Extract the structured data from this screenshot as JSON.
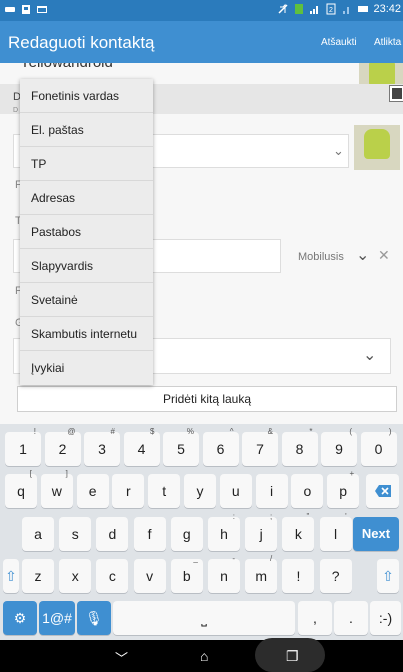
{
  "status": {
    "time": "23:42",
    "icons": [
      "keyboard-icon",
      "image-icon",
      "message-icon",
      "mute-icon",
      "battery-charge-icon",
      "signal-icon",
      "sim-icon",
      "battery-icon"
    ]
  },
  "header": {
    "title": "Redaguoti kontaktą",
    "cancel_label": "Atšaukti",
    "done_label": "Atlikta"
  },
  "form": {
    "partial_name_text": "Yellowandroid",
    "mobile_label": "Mobilusis",
    "add_field_label": "Pridėti kitą lauką"
  },
  "popup": {
    "items": [
      "Fonetinis vardas",
      "El. paštas",
      "TP",
      "Adresas",
      "Pastabos",
      "Slapyvardis",
      "Svetainė",
      "Skambutis internetu",
      "Įvykiai"
    ]
  },
  "keyboard": {
    "row1": [
      {
        "k": "1",
        "a": "!"
      },
      {
        "k": "2",
        "a": "@"
      },
      {
        "k": "3",
        "a": "#"
      },
      {
        "k": "4",
        "a": "$"
      },
      {
        "k": "5",
        "a": "%"
      },
      {
        "k": "6",
        "a": "^"
      },
      {
        "k": "7",
        "a": "&"
      },
      {
        "k": "8",
        "a": "*"
      },
      {
        "k": "9",
        "a": "("
      },
      {
        "k": "0",
        "a": ")"
      }
    ],
    "row2": [
      {
        "k": "q",
        "a": "["
      },
      {
        "k": "w",
        "a": "]"
      },
      {
        "k": "e",
        "a": ""
      },
      {
        "k": "r",
        "a": ""
      },
      {
        "k": "t",
        "a": ""
      },
      {
        "k": "y",
        "a": ""
      },
      {
        "k": "u",
        "a": ""
      },
      {
        "k": "i",
        "a": ""
      },
      {
        "k": "o",
        "a": ""
      },
      {
        "k": "p",
        "a": "+"
      }
    ],
    "row3": [
      {
        "k": "a",
        "a": ""
      },
      {
        "k": "s",
        "a": ""
      },
      {
        "k": "d",
        "a": ""
      },
      {
        "k": "f",
        "a": ""
      },
      {
        "k": "g",
        "a": ""
      },
      {
        "k": "h",
        "a": ":"
      },
      {
        "k": "j",
        "a": ";"
      },
      {
        "k": "k",
        "a": "\""
      },
      {
        "k": "l",
        "a": "'"
      }
    ],
    "row4": [
      {
        "k": "z",
        "a": ""
      },
      {
        "k": "x",
        "a": ""
      },
      {
        "k": "c",
        "a": ""
      },
      {
        "k": "v",
        "a": ""
      },
      {
        "k": "b",
        "a": "_"
      },
      {
        "k": "n",
        "a": "-"
      },
      {
        "k": "m",
        "a": "/"
      },
      {
        "k": "!",
        "a": ""
      },
      {
        "k": "?",
        "a": ""
      }
    ],
    "next_label": "Next",
    "sym_label": "1@#",
    "comma": ",",
    "period": ".",
    "smiley": ":-)"
  },
  "colors": {
    "status_bar": "#2b7bbc",
    "action_bar": "#3f8fd1",
    "accent": "#3f8fd1"
  }
}
